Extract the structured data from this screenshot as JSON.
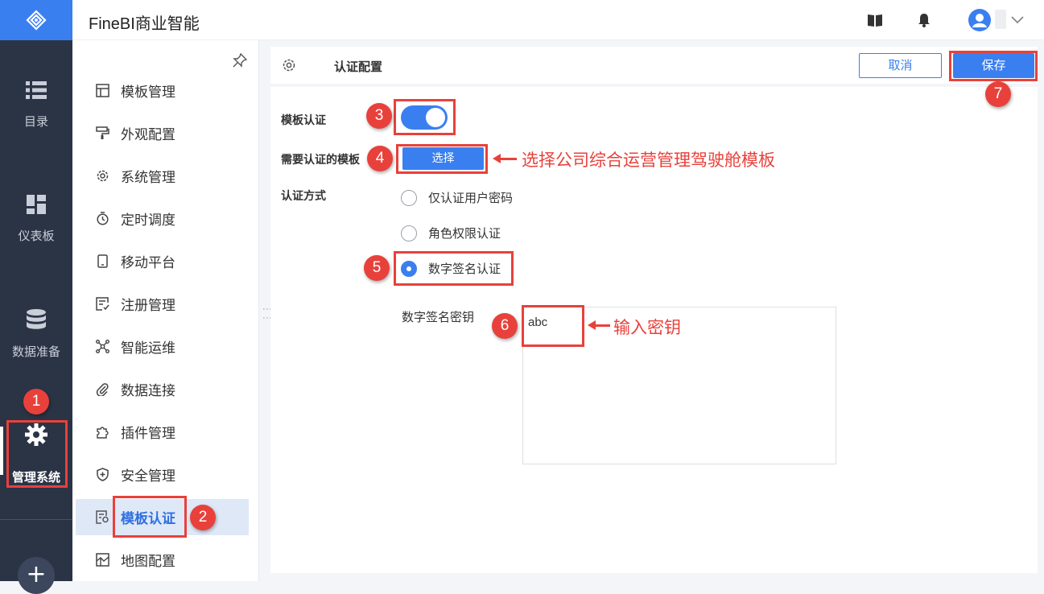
{
  "app": {
    "title": "FineBI商业智能"
  },
  "rail": {
    "items": [
      {
        "label": "目录",
        "icon": "list-icon"
      },
      {
        "label": "仪表板",
        "icon": "dashboard-icon"
      },
      {
        "label": "数据准备",
        "icon": "database-icon"
      },
      {
        "label": "管理系统",
        "icon": "gear-icon",
        "active": true
      }
    ],
    "plus_label": "+"
  },
  "menu": {
    "items": [
      {
        "label": "模板管理",
        "icon": "template-icon"
      },
      {
        "label": "外观配置",
        "icon": "paint-roller-icon"
      },
      {
        "label": "系统管理",
        "icon": "gear-icon"
      },
      {
        "label": "定时调度",
        "icon": "timer-icon"
      },
      {
        "label": "移动平台",
        "icon": "mobile-icon"
      },
      {
        "label": "注册管理",
        "icon": "register-icon"
      },
      {
        "label": "智能运维",
        "icon": "network-icon"
      },
      {
        "label": "数据连接",
        "icon": "paperclip-icon"
      },
      {
        "label": "插件管理",
        "icon": "puzzle-icon"
      },
      {
        "label": "安全管理",
        "icon": "shield-icon"
      },
      {
        "label": "模板认证",
        "icon": "certificate-icon",
        "active": true
      },
      {
        "label": "地图配置",
        "icon": "map-icon"
      }
    ]
  },
  "panel": {
    "title": "认证配置",
    "cancel_label": "取消",
    "save_label": "保存",
    "template_auth_label": "模板认证",
    "template_auth_enabled": true,
    "templates_label": "需要认证的模板",
    "select_label": "选择",
    "method_label": "认证方式",
    "methods": [
      {
        "label": "仅认证用户密码",
        "checked": false
      },
      {
        "label": "角色权限认证",
        "checked": false
      },
      {
        "label": "数字签名认证",
        "checked": true
      }
    ],
    "key_label": "数字签名密钥",
    "key_value": "abc"
  },
  "annotations": {
    "badges": [
      "1",
      "2",
      "3",
      "4",
      "5",
      "6",
      "7"
    ],
    "note_select": "选择公司综合运营管理驾驶舱模板",
    "note_key": "输入密钥"
  },
  "colors": {
    "accent": "#3a7ff0",
    "rail": "#2b3445",
    "annotation": "#e8413b"
  }
}
